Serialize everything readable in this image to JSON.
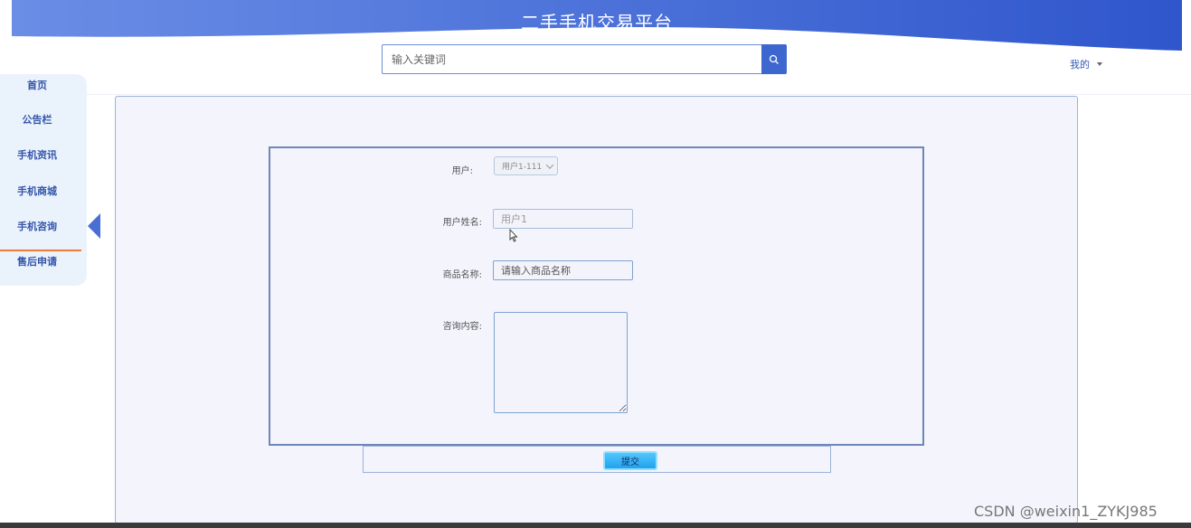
{
  "header": {
    "site_title": "二手手机交易平台",
    "search_placeholder": "输入关键词",
    "user_menu_label": "我的"
  },
  "sidebar": {
    "items": [
      {
        "label": "首页"
      },
      {
        "label": "公告栏"
      },
      {
        "label": "手机资讯"
      },
      {
        "label": "手机商城"
      },
      {
        "label": "手机咨询"
      },
      {
        "label": "售后申请"
      }
    ],
    "active_index": 4
  },
  "form": {
    "user_label": "用户:",
    "user_selected": "用户1-111",
    "username_label": "用户姓名:",
    "username_value": "用户1",
    "product_label": "商品名称:",
    "product_placeholder": "请输入商品名称",
    "content_label": "咨询内容:",
    "content_value": "",
    "submit_label": "提交"
  },
  "watermark": "CSDN @weixin1_ZYKJ985",
  "colors": {
    "accent": "#3d67cf",
    "banner_start": "#5b7fe0",
    "banner_end": "#2f56cc",
    "active_underline": "#f07a3a",
    "submit": "#1fa3ee"
  }
}
